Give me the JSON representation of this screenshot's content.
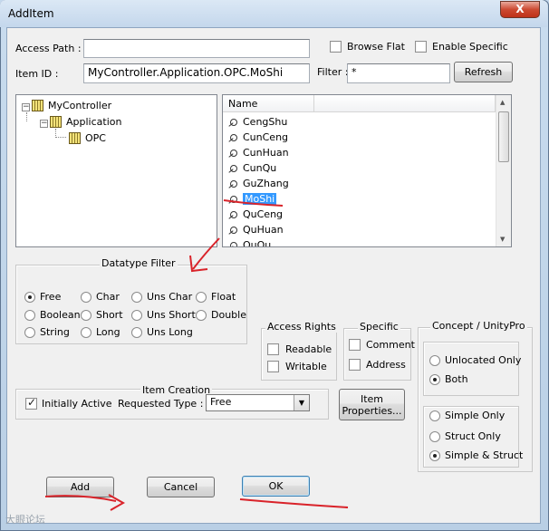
{
  "window": {
    "title": "AddItem",
    "close_glyph": "X"
  },
  "top": {
    "access_path_label": "Access Path :",
    "access_path_value": "",
    "browse_flat_label": "Browse Flat",
    "enable_specific_label": "Enable Specific",
    "item_id_label": "Item ID :",
    "item_id_value": "MyController.Application.OPC.MoShi",
    "filter_label": "Filter :",
    "filter_value": "*",
    "refresh_label": "Refresh"
  },
  "tree": {
    "nodes": [
      {
        "label": "MyController",
        "expander": "−"
      },
      {
        "label": "Application",
        "expander": "−"
      },
      {
        "label": "OPC"
      }
    ]
  },
  "list": {
    "header": "Name",
    "items": [
      "CengShu",
      "CunCeng",
      "CunHuan",
      "CunQu",
      "GuZhang",
      "MoShi",
      "QuCeng",
      "QuHuan",
      "QuQu"
    ],
    "selected": "MoShi"
  },
  "datatype_filter": {
    "title": "Datatype Filter",
    "options": [
      "Free",
      "Char",
      "Uns Char",
      "Float",
      "Boolean",
      "Short",
      "Uns Short",
      "Double",
      "String",
      "Long",
      "Uns Long"
    ],
    "selected": "Free"
  },
  "access_rights": {
    "title": "Access Rights",
    "readable": "Readable",
    "writable": "Writable"
  },
  "specific": {
    "title": "Specific",
    "comment": "Comment",
    "address": "Address"
  },
  "concept": {
    "title": "Concept / UnityPro",
    "group1": [
      "Unlocated Only",
      "Both"
    ],
    "group1_selected": "Both",
    "group2": [
      "Simple Only",
      "Struct Only",
      "Simple & Struct"
    ],
    "group2_selected": "Simple & Struct"
  },
  "item_creation": {
    "title": "Item Creation",
    "initially_active_label": "Initially Active",
    "initially_active_checked": true,
    "requested_type_label": "Requested Type :",
    "requested_type_value": "Free",
    "item_properties_line1": "Item",
    "item_properties_line2": "Properties..."
  },
  "buttons": {
    "add": "Add",
    "cancel": "Cancel",
    "ok": "OK"
  },
  "watermark": "大眼论坛",
  "colors": {
    "selection": "#3399ff",
    "annotation": "#d9232a",
    "title_gradient": "#c4d7ec",
    "close_button": "#cc4a32"
  }
}
